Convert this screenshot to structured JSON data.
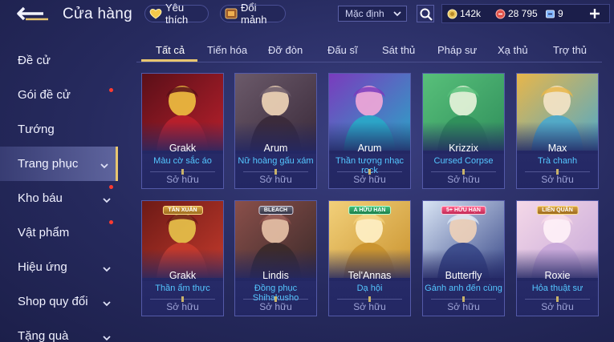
{
  "header": {
    "title": "Cửa hàng",
    "favorites_label": "Yêu thích",
    "exchange_label": "Đổi mảnh",
    "sort_value": "Mặc định"
  },
  "currencies": [
    {
      "icon": "coin-icon",
      "value": "142k",
      "color": "#e8c25a"
    },
    {
      "icon": "voucher-icon",
      "value": "28 795",
      "color": "#e0534a"
    },
    {
      "icon": "ticket-icon",
      "value": "9",
      "color": "#7fb3ff"
    }
  ],
  "sidebar": {
    "items": [
      {
        "label": "Đề cử",
        "chevron": false,
        "dot": false
      },
      {
        "label": "Gói đề cử",
        "chevron": false,
        "dot": true
      },
      {
        "label": "Tướng",
        "chevron": false,
        "dot": false
      },
      {
        "label": "Trang phục",
        "chevron": true,
        "dot": false,
        "active": true
      },
      {
        "label": "Kho báu",
        "chevron": true,
        "dot": true
      },
      {
        "label": "Vật phẩm",
        "chevron": false,
        "dot": true
      },
      {
        "label": "Hiệu ứng",
        "chevron": true,
        "dot": false
      },
      {
        "label": "Shop quy đổi",
        "chevron": true,
        "dot": false
      },
      {
        "label": "Tặng quà",
        "chevron": true,
        "dot": false
      }
    ]
  },
  "tabs": [
    "Tất cả",
    "Tiến hóa",
    "Đỡ đòn",
    "Đấu sĩ",
    "Sát thủ",
    "Pháp sư",
    "Xạ thủ",
    "Trợ thủ"
  ],
  "cards": [
    {
      "hero": "Grakk",
      "skin": "Màu cờ sắc áo",
      "status": "Sở hữu",
      "badge": "",
      "palette": [
        "#b8202c",
        "#5a0f18",
        "#f0c040"
      ]
    },
    {
      "hero": "Arum",
      "skin": "Nữ hoàng gấu xám",
      "status": "Sở hữu",
      "badge": "",
      "palette": [
        "#3a2a3a",
        "#6b5a6a",
        "#f1d6b8"
      ]
    },
    {
      "hero": "Arum",
      "skin": "Thần tượng nhạc rock",
      "status": "Sở hữu",
      "badge": "",
      "palette": [
        "#2aa6c7",
        "#7a3bbd",
        "#f3a8d8"
      ]
    },
    {
      "hero": "Krizzix",
      "skin": "Cursed Corpse",
      "status": "Sở hữu",
      "badge": "",
      "palette": [
        "#2f8e5b",
        "#58c07a",
        "#e8f4dc"
      ]
    },
    {
      "hero": "Max",
      "skin": "Trà chanh",
      "status": "Sở hữu",
      "badge": "",
      "palette": [
        "#4fa9c9",
        "#e8b64a",
        "#f5e4c8"
      ]
    },
    {
      "hero": "Grakk",
      "skin": "Thần ẩm thực",
      "status": "Sở hữu",
      "badge": "TÂN XUÂN",
      "badgeStyle": "",
      "palette": [
        "#c43a2c",
        "#6d1a16",
        "#e8c44a"
      ]
    },
    {
      "hero": "Lindis",
      "skin": "Đồng phục Shihakusho",
      "status": "Sở hữu",
      "badge": "BLEACH",
      "badgeStyle": "gray",
      "palette": [
        "#3b2a2a",
        "#8a4f4a",
        "#e9c3a8"
      ]
    },
    {
      "hero": "Tel'Annas",
      "skin": "Dạ hội",
      "status": "Sở hữu",
      "badge": "A HỮU HẠN",
      "badgeStyle": "green",
      "palette": [
        "#c9922e",
        "#f2d07a",
        "#fff1c8"
      ]
    },
    {
      "hero": "Butterfly",
      "skin": "Gánh anh đến cùng",
      "status": "Sở hữu",
      "badge": "5+ HỮU HẠN",
      "badgeStyle": "pink",
      "palette": [
        "#3a4a8a",
        "#d8e4f4",
        "#f0d2b8"
      ]
    },
    {
      "hero": "Roxie",
      "skin": "Hỏa thuật sư",
      "status": "Sở hữu",
      "badge": "LIÊN QUÂN",
      "badgeStyle": "",
      "palette": [
        "#c7a8d8",
        "#f4d8e8",
        "#fff2f8"
      ]
    }
  ]
}
